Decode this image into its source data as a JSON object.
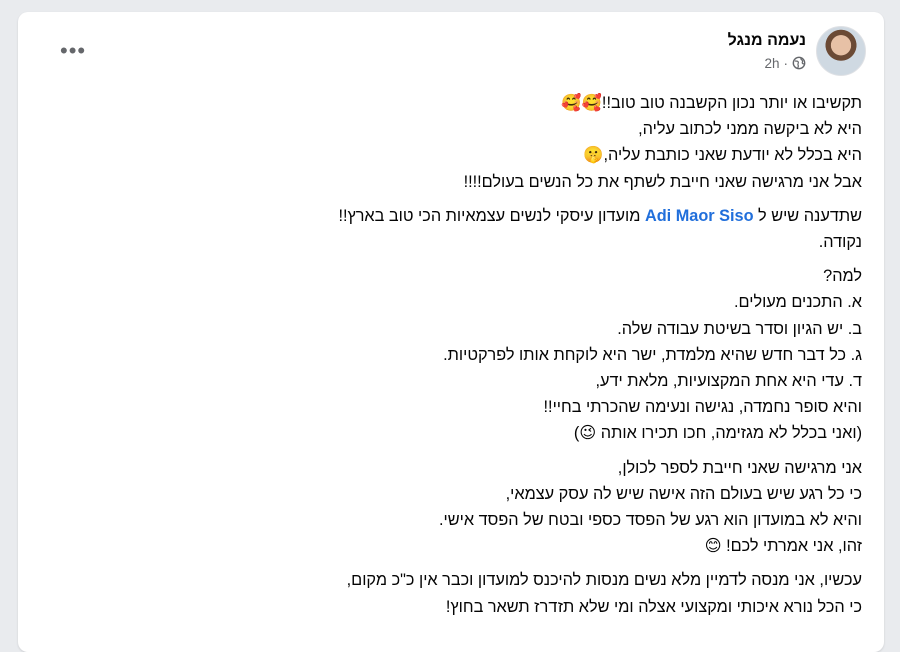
{
  "post": {
    "author": "נעמה מנגל",
    "time": "2h",
    "separator": "·",
    "privacy_icon": "globe-icon",
    "more_icon": "more-options-icon",
    "more_label": "•••"
  },
  "paragraphs": [
    {
      "lines": [
        "תקשיבו או יותר נכון הקשבנה טוב טוב!!🥰🥰",
        "היא לא ביקשה ממני לכתוב עליה,",
        "היא בכלל לא יודעת שאני כותבת עליה,🤫",
        "אבל אני מרגישה שאני חייבת לשתף את כל הנשים בעולם!!!!"
      ]
    },
    {
      "mention_line": {
        "before": "שתדענה שיש ל ",
        "mention": "Adi Maor Siso",
        "after": " מועדון עיסקי לנשים עצמאיות הכי טוב בארץ!!"
      },
      "lines": [
        "נקודה."
      ]
    },
    {
      "lines": [
        "למה?",
        "א. התכנים מעולים.",
        "ב. יש הגיון וסדר בשיטת עבודה שלה.",
        "ג. כל דבר חדש שהיא מלמדת, ישר היא לוקחת אותו לפרקטיות.",
        "ד. עדי היא אחת  המקצועיות, מלאת ידע,",
        "והיא סופר נחמדה, נגישה ונעימה שהכרתי בחיי!!",
        "(ואני בכלל לא מגזימה, חכו תכירו אותה 😉)"
      ]
    },
    {
      "lines": [
        "אני מרגישה שאני חייבת לספר לכולן,",
        "כי כל רגע שיש בעולם הזה אישה שיש לה עסק עצמאי,",
        "והיא לא במועדון הוא רגע של הפסד כספי ובטח של הפסד אישי.",
        "זהו, אני אמרתי לכם! 😊"
      ]
    },
    {
      "lines": [
        "עכשיו, אני מנסה לדמיין מלא נשים מנסות להיכנס למועדון וכבר אין כ\"כ מקום,",
        "כי הכל נורא איכותי ומקצועי אצלה ומי שלא תזדרז תשאר בחוץ!"
      ]
    }
  ]
}
